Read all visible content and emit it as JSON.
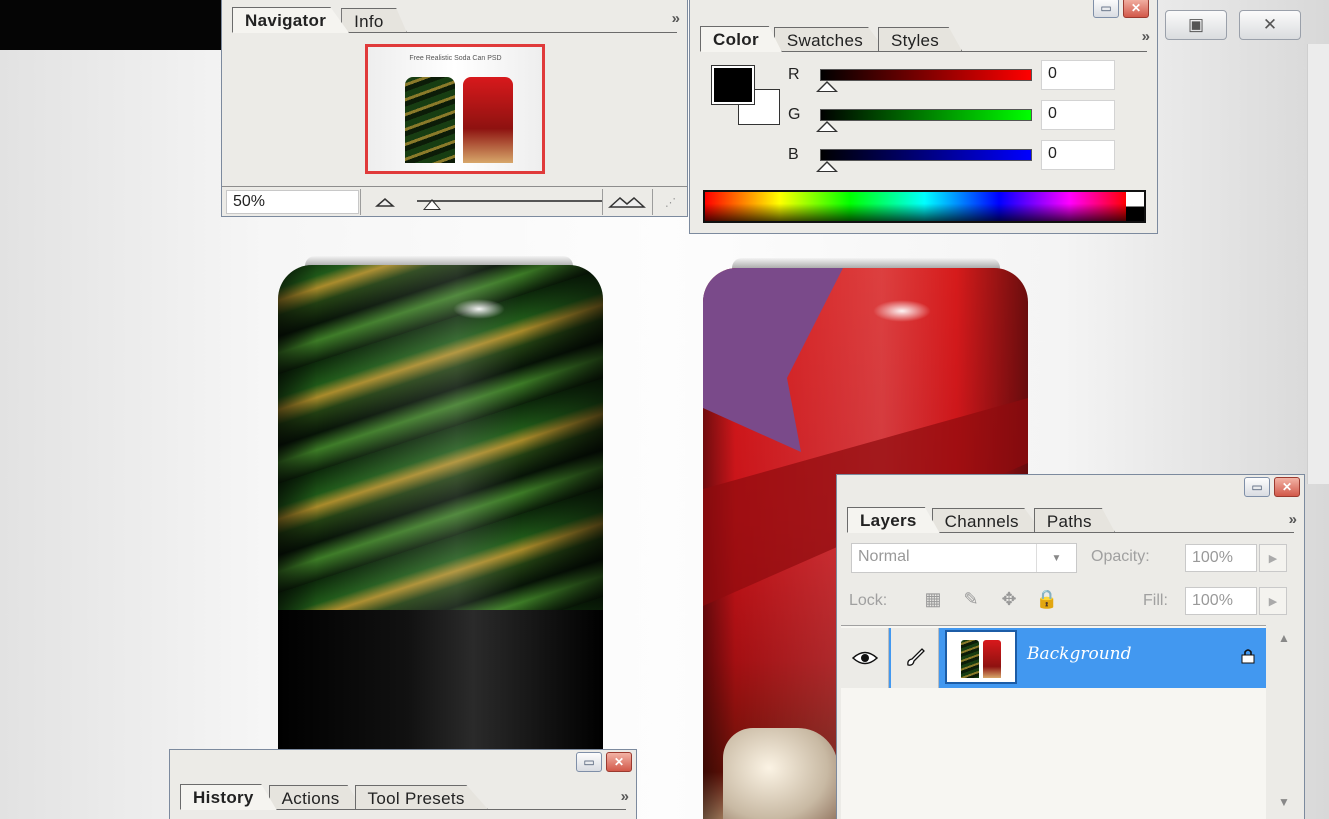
{
  "navigator": {
    "tabs": [
      "Navigator",
      "Info"
    ],
    "active_tab": "Navigator",
    "thumbnail_caption": "Free Realistic Soda Can PSD",
    "zoom_value": "50%",
    "zoom_out_icon": "mountain-small-icon",
    "zoom_in_icon": "mountain-large-icon",
    "more_icon": "»"
  },
  "color": {
    "tabs": [
      "Color",
      "Swatches",
      "Styles"
    ],
    "active_tab": "Color",
    "foreground_color": "#000000",
    "background_color": "#ffffff",
    "channels": [
      {
        "label": "R",
        "value": "0",
        "gradient_end": "#ff0000"
      },
      {
        "label": "G",
        "value": "0",
        "gradient_end": "#00ff00"
      },
      {
        "label": "B",
        "value": "0",
        "gradient_end": "#0000ff"
      }
    ],
    "more_icon": "»"
  },
  "layers": {
    "tabs": [
      "Layers",
      "Channels",
      "Paths"
    ],
    "active_tab": "Layers",
    "blend_mode": "Normal",
    "opacity_label": "Opacity:",
    "opacity_value": "100%",
    "lock_label": "Lock:",
    "fill_label": "Fill:",
    "fill_value": "100%",
    "layer_name": "Background",
    "selected_color": "#4298f0",
    "more_icon": "»"
  },
  "history": {
    "tabs": [
      "History",
      "Actions",
      "Tool Presets"
    ],
    "active_tab": "History",
    "more_icon": "»"
  },
  "window_buttons": {
    "minimize": "▭",
    "restore": "▣",
    "close": "✕"
  }
}
